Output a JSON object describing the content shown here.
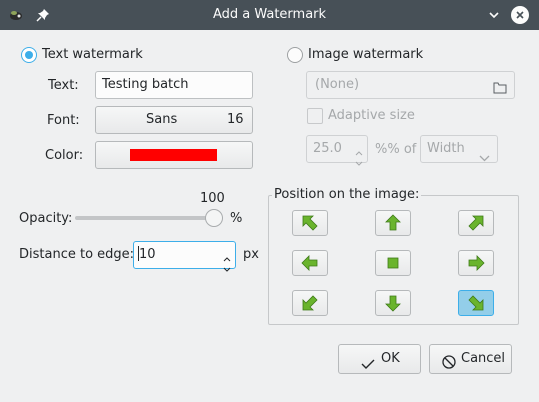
{
  "window": {
    "title": "Add a Watermark",
    "app_icon": "app-icon",
    "pin_icon": "pin-icon",
    "minimize_icon": "chevron-down-icon",
    "close_icon": "close-icon"
  },
  "text_watermark": {
    "radio_label": "Text watermark",
    "selected": true,
    "text_label": "Text:",
    "text_value": "Testing batch",
    "font_label": "Font:",
    "font_name": "Sans",
    "font_size": "16",
    "color_label": "Color:",
    "color_value": "#ff0000"
  },
  "image_watermark": {
    "radio_label": "Image watermark",
    "selected": false,
    "file_value": "(None)",
    "adaptive_label": "Adaptive size",
    "adaptive_checked": false,
    "percent_value": "25.0",
    "percent_of_label": "%% of",
    "dimension_value": "Width"
  },
  "opacity": {
    "label": "Opacity:",
    "value": "100",
    "unit": "%",
    "level": 1.0
  },
  "distance": {
    "label": "Distance to edge:",
    "value": "10",
    "unit": "px"
  },
  "position": {
    "label": "Position on the image:",
    "selected": "bottom-right",
    "buttons": [
      "top-left",
      "top",
      "top-right",
      "left",
      "center",
      "right",
      "bottom-left",
      "bottom",
      "bottom-right"
    ]
  },
  "buttons": {
    "ok_label": "OK",
    "cancel_label": "Cancel"
  },
  "colors": {
    "accent": "#3daee9",
    "arrow": "#6ab42d",
    "titlebar": "#475057"
  }
}
